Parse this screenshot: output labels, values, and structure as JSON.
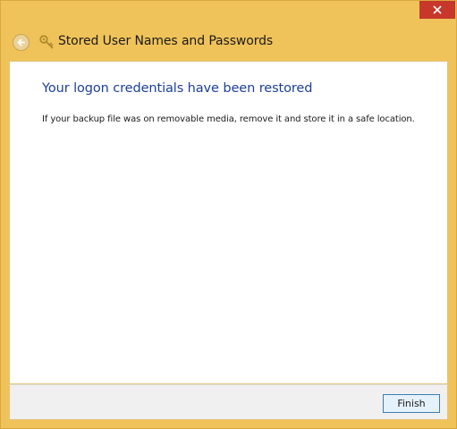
{
  "window": {
    "title": "Stored User Names and Passwords",
    "frame_color": "#f0c35a",
    "close_button_color": "#c7372a"
  },
  "icons": {
    "back": "back-arrow-icon",
    "title_icon": "key-icon",
    "close": "close-icon"
  },
  "content": {
    "heading": "Your logon credentials have been restored",
    "heading_color": "#1d3f9a",
    "body": "If your backup file was on removable media, remove it and store it in a safe location."
  },
  "footer": {
    "finish_label": "Finish"
  }
}
